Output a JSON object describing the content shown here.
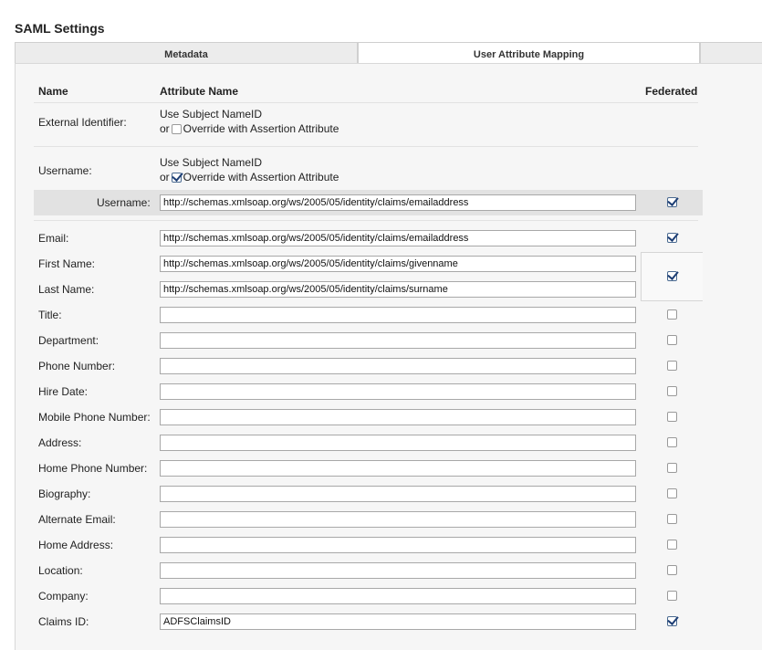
{
  "page_title": "SAML Settings",
  "tabs": {
    "metadata": "Metadata",
    "mapping": "User Attribute Mapping"
  },
  "headers": {
    "name": "Name",
    "attribute_name": "Attribute Name",
    "federated": "Federated"
  },
  "external_identifier": {
    "label": "External Identifier:",
    "option1": "Use Subject NameID",
    "or": "or",
    "option2": "Override with Assertion Attribute",
    "override_checked": false
  },
  "username_mode": {
    "label": "Username:",
    "option1": "Use Subject NameID",
    "or": "or",
    "option2": "Override with Assertion Attribute",
    "override_checked": true
  },
  "username_attr": {
    "label": "Username:",
    "value": "http://schemas.xmlsoap.org/ws/2005/05/identity/claims/emailaddress",
    "federated": true
  },
  "fields": [
    {
      "label": "Email:",
      "value": "http://schemas.xmlsoap.org/ws/2005/05/identity/claims/emailaddress",
      "federated": true
    },
    {
      "label": "First Name:",
      "value": "http://schemas.xmlsoap.org/ws/2005/05/identity/claims/givenname",
      "federated": true
    },
    {
      "label": "Last Name:",
      "value": "http://schemas.xmlsoap.org/ws/2005/05/identity/claims/surname",
      "federated": true
    },
    {
      "label": "Title:",
      "value": "",
      "federated": false
    },
    {
      "label": "Department:",
      "value": "",
      "federated": false
    },
    {
      "label": "Phone Number:",
      "value": "",
      "federated": false
    },
    {
      "label": "Hire Date:",
      "value": "",
      "federated": false
    },
    {
      "label": "Mobile Phone Number:",
      "value": "",
      "federated": false
    },
    {
      "label": "Address:",
      "value": "",
      "federated": false
    },
    {
      "label": "Home Phone Number:",
      "value": "",
      "federated": false
    },
    {
      "label": "Biography:",
      "value": "",
      "federated": false
    },
    {
      "label": "Alternate Email:",
      "value": "",
      "federated": false
    },
    {
      "label": "Home Address:",
      "value": "",
      "federated": false
    },
    {
      "label": "Location:",
      "value": "",
      "federated": false
    },
    {
      "label": "Company:",
      "value": "",
      "federated": false
    },
    {
      "label": "Claims ID:",
      "value": "ADFSClaimsID",
      "federated": true
    }
  ]
}
